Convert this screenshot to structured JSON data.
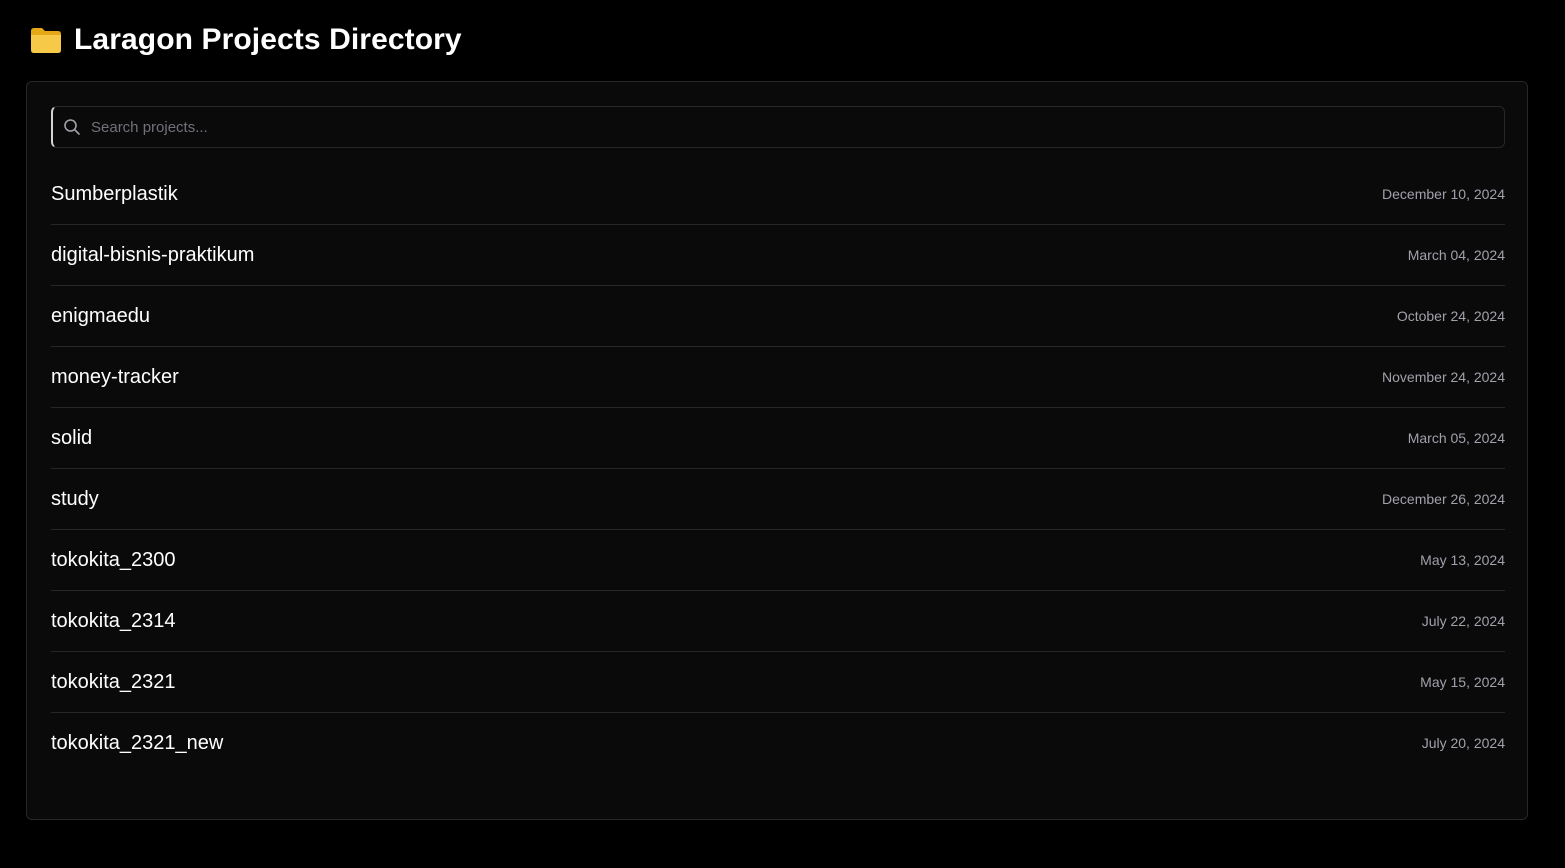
{
  "header": {
    "icon": "folder-icon",
    "title": "Laragon Projects Directory"
  },
  "search": {
    "icon": "search-icon",
    "value": "",
    "placeholder": "Search projects..."
  },
  "colors": {
    "background": "#000000",
    "panel": "#0a0a0b",
    "border": "#27272a",
    "date_text": "#a1a1aa",
    "folder_yellow": "#f7c948"
  },
  "projects": [
    {
      "name": "Sumberplastik",
      "date": "December 10, 2024"
    },
    {
      "name": "digital-bisnis-praktikum",
      "date": "March 04, 2024"
    },
    {
      "name": "enigmaedu",
      "date": "October 24, 2024"
    },
    {
      "name": "money-tracker",
      "date": "November 24, 2024"
    },
    {
      "name": "solid",
      "date": "March 05, 2024"
    },
    {
      "name": "study",
      "date": "December 26, 2024"
    },
    {
      "name": "tokokita_2300",
      "date": "May 13, 2024"
    },
    {
      "name": "tokokita_2314",
      "date": "July 22, 2024"
    },
    {
      "name": "tokokita_2321",
      "date": "May 15, 2024"
    },
    {
      "name": "tokokita_2321_new",
      "date": "July 20, 2024"
    }
  ]
}
